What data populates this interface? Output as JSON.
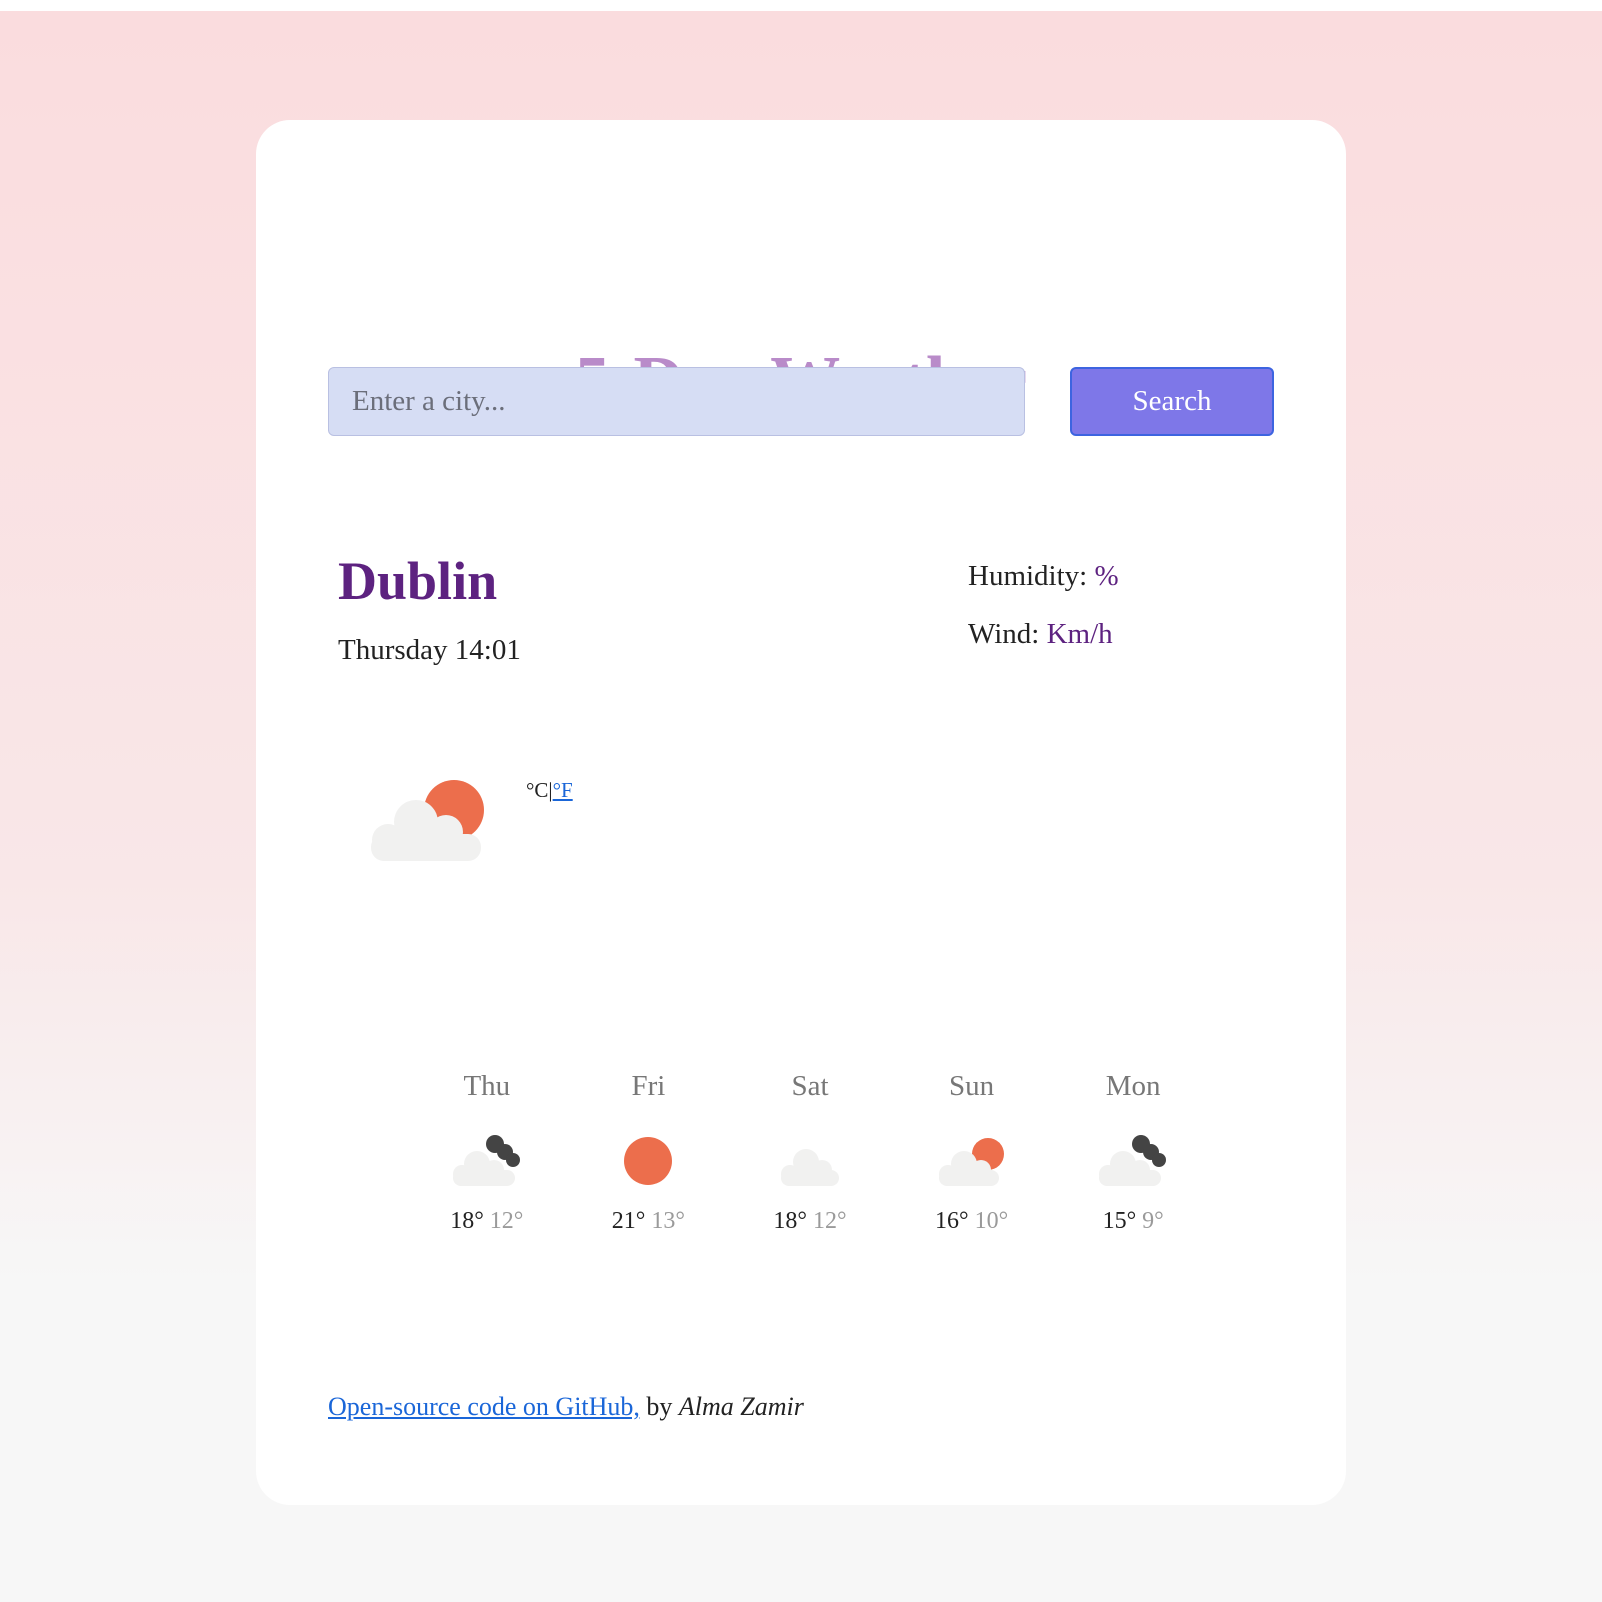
{
  "app": {
    "title": "5-Day Weather"
  },
  "search": {
    "placeholder": "Enter a city...",
    "value": "",
    "button_label": "Search"
  },
  "current": {
    "city": "Dublin",
    "datetime": "Thursday 14:01",
    "humidity_label": "Humidity:",
    "humidity_value": "%",
    "wind_label": "Wind:",
    "wind_value": "Km/h",
    "icon": "partly-cloudy-day-icon",
    "unit_celsius": "°C",
    "unit_separator": "|",
    "unit_fahrenheit": "°F"
  },
  "forecast": [
    {
      "day": "Thu",
      "icon": "partly-cloudy-night-icon",
      "max": "18°",
      "min": "12°"
    },
    {
      "day": "Fri",
      "icon": "sun-icon",
      "max": "21°",
      "min": "13°"
    },
    {
      "day": "Sat",
      "icon": "cloud-icon",
      "max": "18°",
      "min": "12°"
    },
    {
      "day": "Sun",
      "icon": "partly-cloudy-day-icon",
      "max": "16°",
      "min": "10°"
    },
    {
      "day": "Mon",
      "icon": "partly-cloudy-night-icon",
      "max": "15°",
      "min": "9°"
    }
  ],
  "footer": {
    "link_text": "Open-source code on GitHub,",
    "by_text": " by ",
    "author": "Alma Zamir"
  },
  "colors": {
    "title": "#b98bc9",
    "accent": "#5d2280",
    "button": "#7e77e8",
    "sun": "#ec6e4c",
    "cloud": "#f1f1f0",
    "moon": "#444444"
  }
}
